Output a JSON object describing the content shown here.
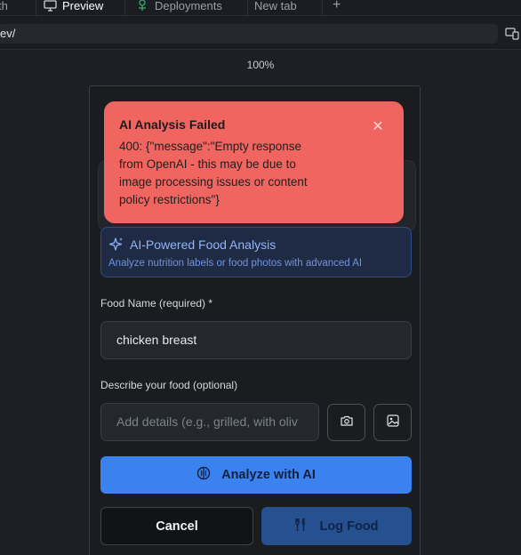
{
  "tabs": [
    {
      "label": "th",
      "icon": "none"
    },
    {
      "label": "Preview",
      "icon": "monitor-icon"
    },
    {
      "label": "Deployments",
      "icon": "deployments-icon"
    },
    {
      "label": "New tab",
      "icon": "none"
    }
  ],
  "new_tab_symbol": "+",
  "url": "ev/",
  "zoom": "100%",
  "toast": {
    "title": "AI Analysis Failed",
    "message": "400: {\"message\":\"Empty response from OpenAI - this may be due to image processing issues or content policy restrictions\"}",
    "close_symbol": "✕"
  },
  "ai_banner": {
    "title": "AI-Powered Food Analysis",
    "subtitle": "Analyze nutrition labels or food photos with advanced AI"
  },
  "form": {
    "food_name_label": "Food Name (required) *",
    "food_name_value": "chicken breast",
    "describe_label": "Describe your food (optional)",
    "describe_placeholder": "Add details (e.g., grilled, with oliv"
  },
  "buttons": {
    "analyze": "Analyze with AI",
    "cancel": "Cancel",
    "log": "Log Food"
  },
  "colors": {
    "toast_bg": "#f06560",
    "primary_blue": "#3b82f0",
    "banner_bg": "#1f2b45"
  }
}
